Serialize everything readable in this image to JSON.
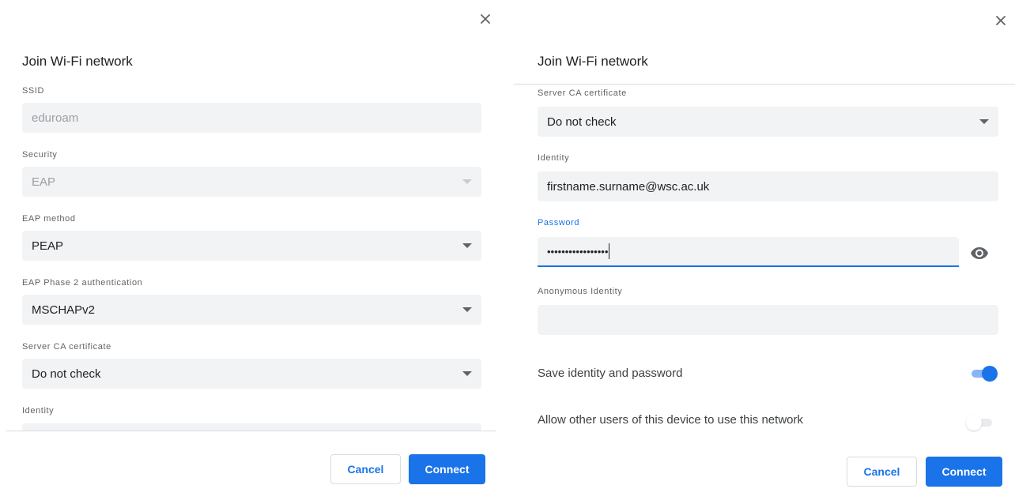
{
  "left_dialog": {
    "title": "Join Wi-Fi network",
    "ssid": {
      "label": "SSID",
      "value": "eduroam"
    },
    "security": {
      "label": "Security",
      "value": "EAP"
    },
    "eap_method": {
      "label": "EAP method",
      "value": "PEAP"
    },
    "phase2": {
      "label": "EAP Phase 2 authentication",
      "value": "MSCHAPv2"
    },
    "server_ca": {
      "label": "Server CA certificate",
      "value": "Do not check"
    },
    "identity": {
      "label": "Identity"
    },
    "buttons": {
      "cancel": "Cancel",
      "connect": "Connect"
    }
  },
  "right_dialog": {
    "title": "Join Wi-Fi network",
    "server_ca": {
      "label": "Server CA certificate",
      "value": "Do not check"
    },
    "identity": {
      "label": "Identity",
      "value": "firstname.surname@wsc.ac.uk"
    },
    "password": {
      "label": "Password",
      "value": "•••••••••••••••••"
    },
    "anonymous_identity": {
      "label": "Anonymous Identity",
      "value": ""
    },
    "save_identity": {
      "label": "Save identity and password",
      "on": true
    },
    "share_network": {
      "label": "Allow other users of this device to use this network",
      "on": false
    },
    "buttons": {
      "cancel": "Cancel",
      "connect": "Connect"
    }
  },
  "icons": {
    "close": "close-icon",
    "dropdown": "dropdown-arrow-icon",
    "show_password": "eye-icon"
  },
  "colors": {
    "accent": "#1a73e8",
    "field_bg": "#f1f3f4",
    "label": "#5f6368",
    "text": "#202124"
  }
}
